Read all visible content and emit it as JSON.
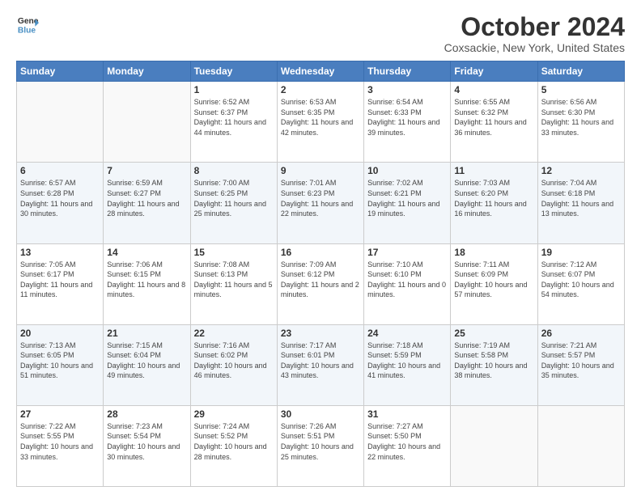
{
  "logo": {
    "line1": "General",
    "line2": "Blue"
  },
  "title": "October 2024",
  "location": "Coxsackie, New York, United States",
  "weekdays": [
    "Sunday",
    "Monday",
    "Tuesday",
    "Wednesday",
    "Thursday",
    "Friday",
    "Saturday"
  ],
  "weeks": [
    [
      {
        "day": "",
        "info": ""
      },
      {
        "day": "",
        "info": ""
      },
      {
        "day": "1",
        "info": "Sunrise: 6:52 AM\nSunset: 6:37 PM\nDaylight: 11 hours and 44 minutes."
      },
      {
        "day": "2",
        "info": "Sunrise: 6:53 AM\nSunset: 6:35 PM\nDaylight: 11 hours and 42 minutes."
      },
      {
        "day": "3",
        "info": "Sunrise: 6:54 AM\nSunset: 6:33 PM\nDaylight: 11 hours and 39 minutes."
      },
      {
        "day": "4",
        "info": "Sunrise: 6:55 AM\nSunset: 6:32 PM\nDaylight: 11 hours and 36 minutes."
      },
      {
        "day": "5",
        "info": "Sunrise: 6:56 AM\nSunset: 6:30 PM\nDaylight: 11 hours and 33 minutes."
      }
    ],
    [
      {
        "day": "6",
        "info": "Sunrise: 6:57 AM\nSunset: 6:28 PM\nDaylight: 11 hours and 30 minutes."
      },
      {
        "day": "7",
        "info": "Sunrise: 6:59 AM\nSunset: 6:27 PM\nDaylight: 11 hours and 28 minutes."
      },
      {
        "day": "8",
        "info": "Sunrise: 7:00 AM\nSunset: 6:25 PM\nDaylight: 11 hours and 25 minutes."
      },
      {
        "day": "9",
        "info": "Sunrise: 7:01 AM\nSunset: 6:23 PM\nDaylight: 11 hours and 22 minutes."
      },
      {
        "day": "10",
        "info": "Sunrise: 7:02 AM\nSunset: 6:21 PM\nDaylight: 11 hours and 19 minutes."
      },
      {
        "day": "11",
        "info": "Sunrise: 7:03 AM\nSunset: 6:20 PM\nDaylight: 11 hours and 16 minutes."
      },
      {
        "day": "12",
        "info": "Sunrise: 7:04 AM\nSunset: 6:18 PM\nDaylight: 11 hours and 13 minutes."
      }
    ],
    [
      {
        "day": "13",
        "info": "Sunrise: 7:05 AM\nSunset: 6:17 PM\nDaylight: 11 hours and 11 minutes."
      },
      {
        "day": "14",
        "info": "Sunrise: 7:06 AM\nSunset: 6:15 PM\nDaylight: 11 hours and 8 minutes."
      },
      {
        "day": "15",
        "info": "Sunrise: 7:08 AM\nSunset: 6:13 PM\nDaylight: 11 hours and 5 minutes."
      },
      {
        "day": "16",
        "info": "Sunrise: 7:09 AM\nSunset: 6:12 PM\nDaylight: 11 hours and 2 minutes."
      },
      {
        "day": "17",
        "info": "Sunrise: 7:10 AM\nSunset: 6:10 PM\nDaylight: 11 hours and 0 minutes."
      },
      {
        "day": "18",
        "info": "Sunrise: 7:11 AM\nSunset: 6:09 PM\nDaylight: 10 hours and 57 minutes."
      },
      {
        "day": "19",
        "info": "Sunrise: 7:12 AM\nSunset: 6:07 PM\nDaylight: 10 hours and 54 minutes."
      }
    ],
    [
      {
        "day": "20",
        "info": "Sunrise: 7:13 AM\nSunset: 6:05 PM\nDaylight: 10 hours and 51 minutes."
      },
      {
        "day": "21",
        "info": "Sunrise: 7:15 AM\nSunset: 6:04 PM\nDaylight: 10 hours and 49 minutes."
      },
      {
        "day": "22",
        "info": "Sunrise: 7:16 AM\nSunset: 6:02 PM\nDaylight: 10 hours and 46 minutes."
      },
      {
        "day": "23",
        "info": "Sunrise: 7:17 AM\nSunset: 6:01 PM\nDaylight: 10 hours and 43 minutes."
      },
      {
        "day": "24",
        "info": "Sunrise: 7:18 AM\nSunset: 5:59 PM\nDaylight: 10 hours and 41 minutes."
      },
      {
        "day": "25",
        "info": "Sunrise: 7:19 AM\nSunset: 5:58 PM\nDaylight: 10 hours and 38 minutes."
      },
      {
        "day": "26",
        "info": "Sunrise: 7:21 AM\nSunset: 5:57 PM\nDaylight: 10 hours and 35 minutes."
      }
    ],
    [
      {
        "day": "27",
        "info": "Sunrise: 7:22 AM\nSunset: 5:55 PM\nDaylight: 10 hours and 33 minutes."
      },
      {
        "day": "28",
        "info": "Sunrise: 7:23 AM\nSunset: 5:54 PM\nDaylight: 10 hours and 30 minutes."
      },
      {
        "day": "29",
        "info": "Sunrise: 7:24 AM\nSunset: 5:52 PM\nDaylight: 10 hours and 28 minutes."
      },
      {
        "day": "30",
        "info": "Sunrise: 7:26 AM\nSunset: 5:51 PM\nDaylight: 10 hours and 25 minutes."
      },
      {
        "day": "31",
        "info": "Sunrise: 7:27 AM\nSunset: 5:50 PM\nDaylight: 10 hours and 22 minutes."
      },
      {
        "day": "",
        "info": ""
      },
      {
        "day": "",
        "info": ""
      }
    ]
  ]
}
